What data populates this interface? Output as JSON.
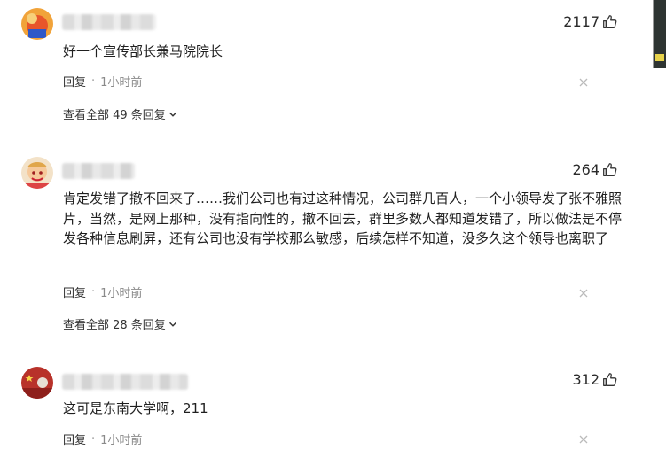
{
  "comments": [
    {
      "likes": "2117",
      "text": "好一个宣传部长兼马院院长",
      "reply_label": "回复",
      "separator": "·",
      "time": "1小时前",
      "view_all": "查看全部 49 条回复"
    },
    {
      "likes": "264",
      "text": "肯定发错了撤不回来了……我们公司也有过这种情况，公司群几百人，一个小领导发了张不雅照片，当然，是网上那种，没有指向性的，撤不回去，群里多数人都知道发错了，所以做法是不停发各种信息刷屏，还有公司也没有学校那么敏感，后续怎样不知道，没多久这个领导也离职了",
      "reply_label": "回复",
      "separator": "·",
      "time": "1小时前",
      "view_all": "查看全部 28 条回复"
    },
    {
      "likes": "312",
      "text": "这可是东南大学啊，211",
      "reply_label": "回复",
      "separator": "·",
      "time": "1小时前"
    }
  ],
  "icons": {
    "like": "thumbs-up-icon",
    "close": "close-icon",
    "expand": "chevron-down-icon"
  },
  "colors": {
    "text": "#1f1f1f",
    "meta": "#8a8a8a",
    "icon": "#333333"
  }
}
